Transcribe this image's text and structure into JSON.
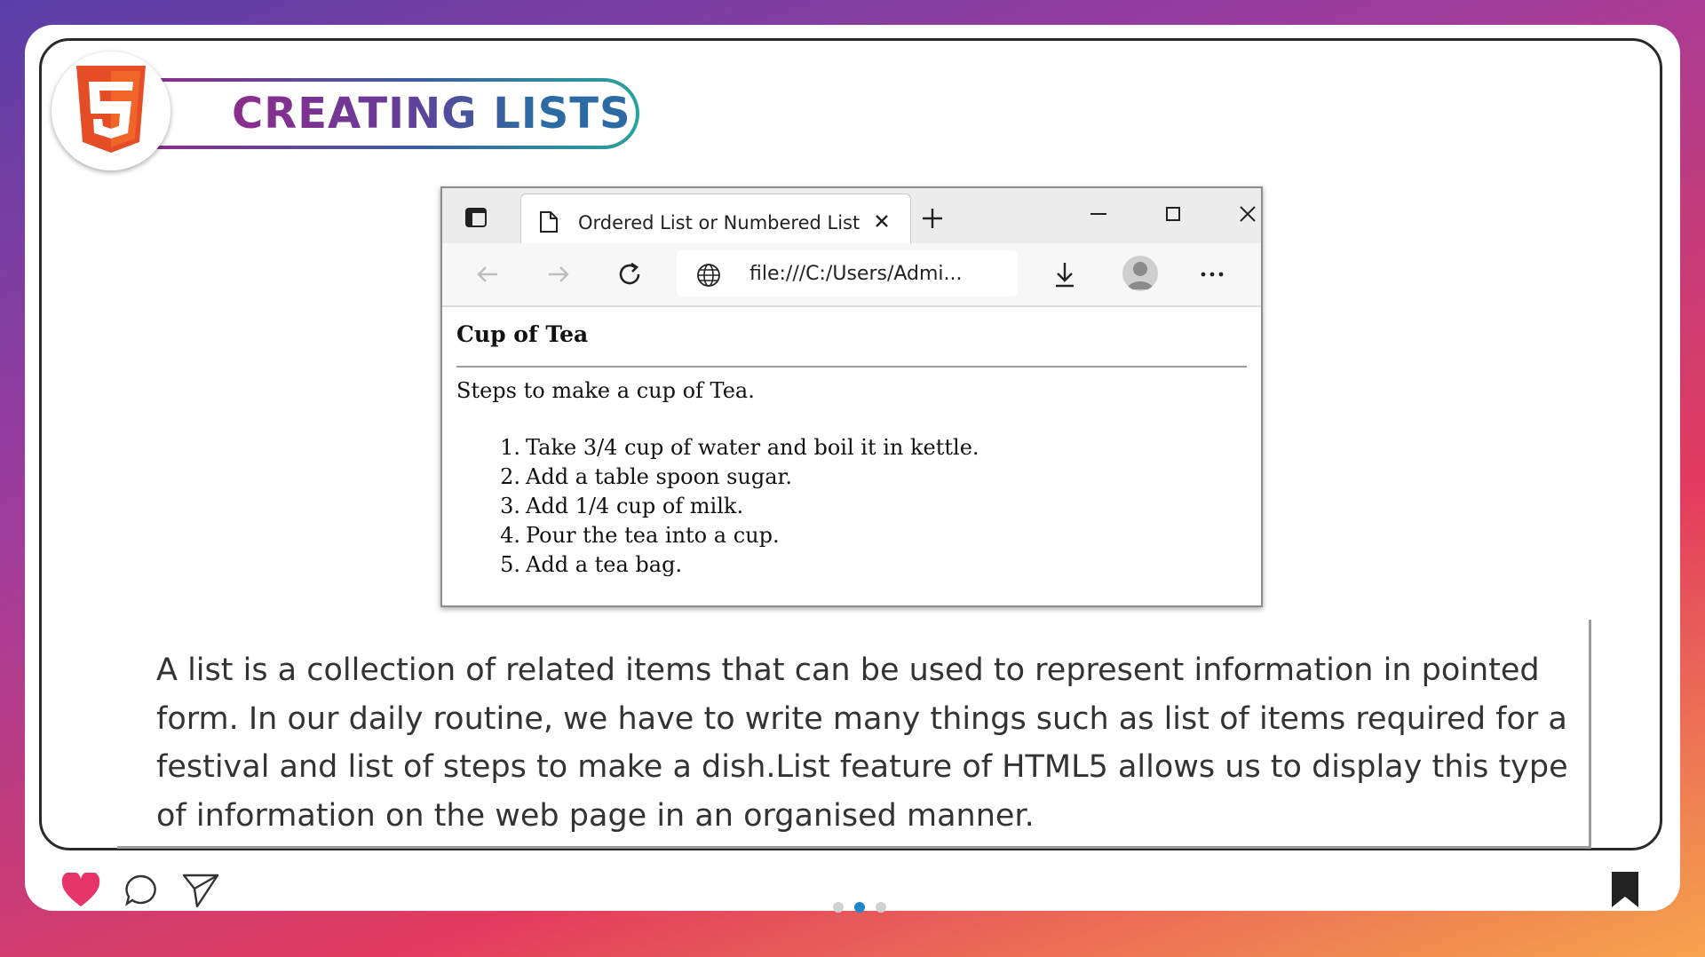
{
  "header": {
    "title": "CREATING LISTS",
    "logo_icon": "html5-logo-icon"
  },
  "browser": {
    "tab_title": "Ordered List or Numbered List",
    "address": "file:///C:/Users/Admi...",
    "page": {
      "heading": "Cup of Tea",
      "intro": "Steps to make a cup of Tea.",
      "steps": [
        {
          "num": "1.",
          "text": "Take 3/4 cup of water and boil it in kettle."
        },
        {
          "num": "2.",
          "text": "Add a table spoon sugar."
        },
        {
          "num": "3.",
          "text": "Add 1/4 cup of milk."
        },
        {
          "num": "4.",
          "text": "Pour the tea into a cup."
        },
        {
          "num": "5.",
          "text": "Add a tea bag."
        }
      ]
    }
  },
  "description": "A list is a collection of related items that can be used to represent information in pointed form. In our daily routine, we have to write many things such as list of items required for a festival and list of steps to make a dish.List feature of HTML5 allows us to display this type of information on the web page in an organised manner.",
  "footer": {
    "icons": [
      "heart-icon",
      "comment-icon",
      "send-icon",
      "bookmark-icon"
    ],
    "active_dot": 2,
    "dot_count": 3
  },
  "colors": {
    "accent": "#e6356b",
    "dot_active": "#1e88c8",
    "html5": "#e44d26"
  }
}
